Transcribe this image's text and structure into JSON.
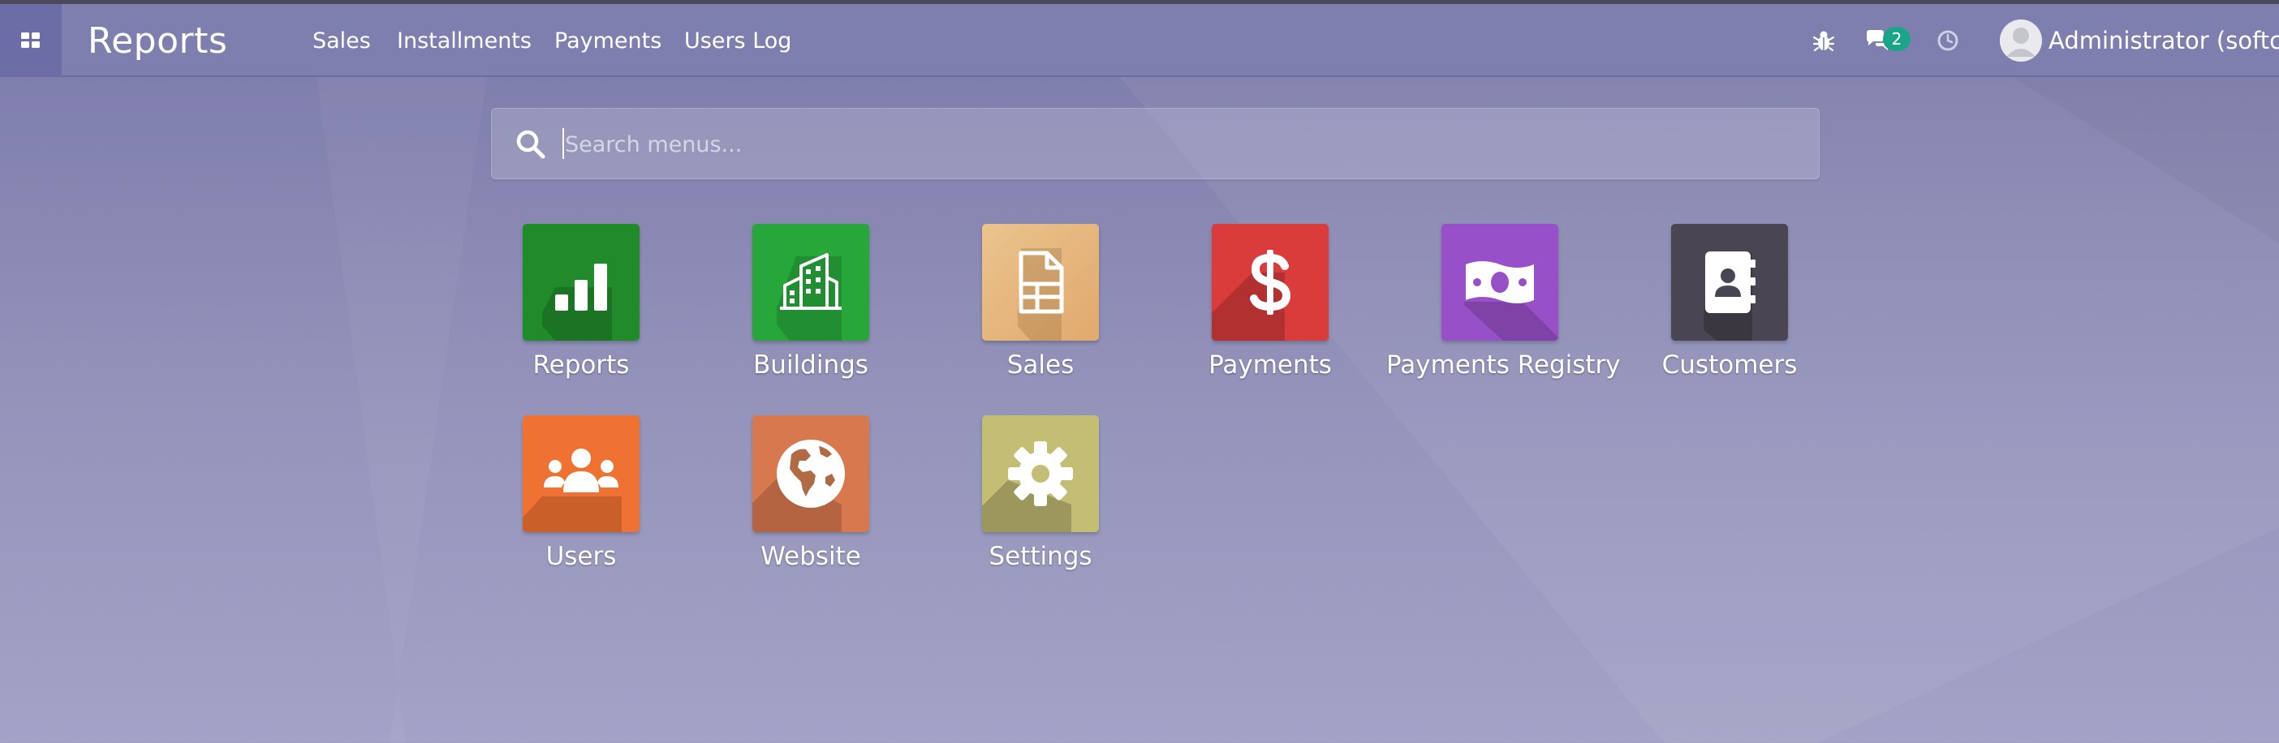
{
  "navbar": {
    "brand": "Reports",
    "menu": [
      {
        "label": "Sales"
      },
      {
        "label": "Installments"
      },
      {
        "label": "Payments"
      },
      {
        "label": "Users Log"
      }
    ],
    "messages_badge": "2",
    "user_name": "Administrator (softcod"
  },
  "search": {
    "placeholder": "Search menus..."
  },
  "apps": [
    {
      "label": "Reports",
      "icon": "bar-chart-icon",
      "color": "#208a2a"
    },
    {
      "label": "Buildings",
      "icon": "building-icon",
      "color": "#27a63a"
    },
    {
      "label": "Sales",
      "icon": "document-icon",
      "color": "#e6b47e"
    },
    {
      "label": "Payments",
      "icon": "dollar-icon",
      "color": "#da3b3b"
    },
    {
      "label": "Payments Registry",
      "icon": "money-bill-icon",
      "color": "#9850c8"
    },
    {
      "label": "Customers",
      "icon": "address-book-icon",
      "color": "#4a4552"
    },
    {
      "label": "Users",
      "icon": "users-icon",
      "color": "#f07232"
    },
    {
      "label": "Website",
      "icon": "globe-icon",
      "color": "#d8784e"
    },
    {
      "label": "Settings",
      "icon": "gear-icon",
      "color": "#c4bd74"
    }
  ],
  "colors": {
    "navbar": "#7e7eaf",
    "background": "#8f8fb9",
    "badge": "#1aa58b"
  }
}
